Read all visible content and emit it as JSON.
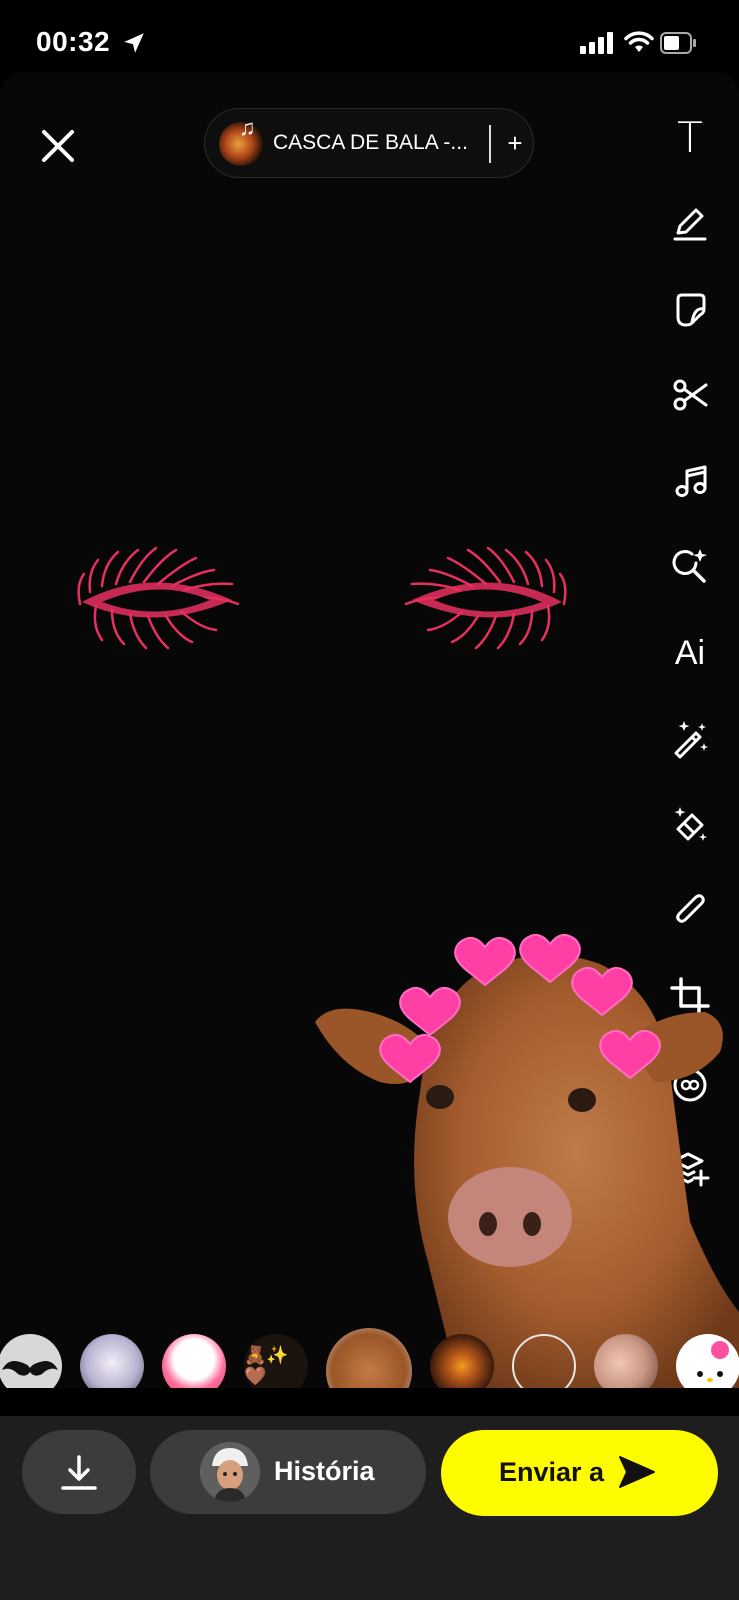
{
  "status_bar": {
    "time": "00:32",
    "icons": [
      "location-arrow-icon",
      "cellular-signal-icon",
      "wifi-icon",
      "battery-icon"
    ]
  },
  "top": {
    "close_icon": "close-icon",
    "music": {
      "title": "CASCA DE BALA -...",
      "plus": "+"
    }
  },
  "tools": [
    "text-tool-icon",
    "pen-tool-icon",
    "sticker-tool-icon",
    "scissors-tool-icon",
    "music-tool-icon",
    "search-sparkle-tool-icon",
    "ai-tool-icon",
    "magic-wand-tool-icon",
    "eraser-tool-icon",
    "paperclip-tool-icon",
    "crop-tool-icon",
    "timer-tool-icon",
    "layers-add-tool-icon"
  ],
  "tool_text_glyph": "T",
  "tool_ai_glyph": "Ai",
  "sticker_tray": [
    "mustache",
    "anime-cat-girl",
    "hello-kitty-bow",
    "emoji-sticker",
    "cow-with-hearts",
    "eye-sticker",
    "blank-circle",
    "selfie-girl",
    "hello-kitty-face"
  ],
  "emoji_sticker_text": "🧸✨🤎",
  "bottom": {
    "story_label": "História",
    "send_label": "Enviar a",
    "save_icon": "download-icon"
  },
  "colors": {
    "accent_yellow": "#fffc00",
    "lash_pink": "#e8305f",
    "heart_pink": "#ff3fa4"
  }
}
